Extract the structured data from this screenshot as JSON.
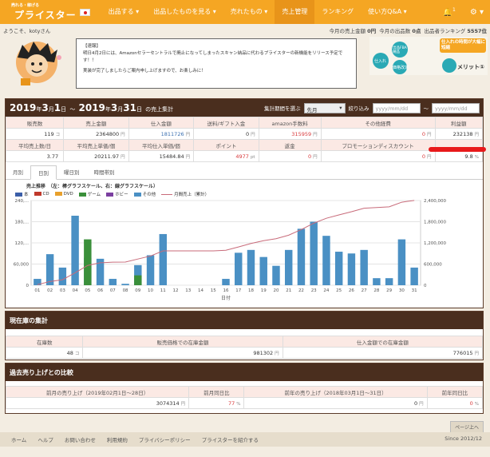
{
  "nav": {
    "logo_small": "売れる・稼げる",
    "logo": "プライスター",
    "items": [
      "出品する",
      "出品したものを見る",
      "売れたもの",
      "売上管理",
      "ランキング",
      "使い方Q&A"
    ],
    "notify_count": "1"
  },
  "subbar": {
    "welcome": "ようこそ、kotyさん",
    "today_sales_label": "今月の売上金額",
    "today_sales": "0円",
    "today_count_label": "今月の出品数",
    "today_count": "0点",
    "rank_label": "出品者ランキング",
    "rank": "5557位"
  },
  "notice": {
    "title": "【速報】",
    "line1": "明日4月2日には、Amazonセラーセントラルで廃止になってしまったスキャン納品に代わるプライスターの新機能をリリース予定です！！",
    "line2": "実装が完了しましたらご案内申し上げますので、お楽しみに！"
  },
  "banner": {
    "title": "仕入れの時間が大幅に短縮",
    "merit": "メリット①",
    "a": "仕入れ",
    "b": "出品FBA納品",
    "c": "価格改定"
  },
  "summary": {
    "year1": "2019",
    "month1": "3",
    "day1": "1",
    "year2": "2019",
    "month2": "3",
    "day2": "31",
    "suffix": "の売上集計",
    "y": "年",
    "m": "月",
    "d": "日",
    "tilde": "〜",
    "period_label": "集計期間を選ぶ",
    "period_value": "先月",
    "filter_label": "絞り込み",
    "date_ph": "yyyy/mm/dd",
    "labels1": [
      "販売数",
      "売上金額",
      "仕入金額",
      "送料/ギフト入金",
      "amazon手数料",
      "その他経費",
      "利益額"
    ],
    "values1": [
      "119",
      "2364800",
      "1811726",
      "0",
      "315959",
      "0",
      "232138"
    ],
    "units1": [
      "コ",
      "円",
      "円",
      "円",
      "円",
      "円",
      "円"
    ],
    "labels2": [
      "平均売上数/日",
      "平均売上単価/個",
      "平均仕入単価/個",
      "ポイント",
      "返金",
      "プロモーションディスカウント",
      ""
    ],
    "values2": [
      "3.77",
      "20211.97",
      "15484.84",
      "4977",
      "0",
      "0",
      "9.8"
    ],
    "units2": [
      "",
      "円",
      "円",
      "pt",
      "円",
      "円",
      "%"
    ]
  },
  "tabs": [
    "月別",
    "日別",
    "曜日別",
    "時間帯別"
  ],
  "chart_data": {
    "type": "bar",
    "title": "売上推移　（左：棒グラフスケール、右：線グラフスケール）",
    "xlabel": "日付",
    "categories": [
      "01",
      "02",
      "03",
      "04",
      "05",
      "06",
      "07",
      "08",
      "09",
      "10",
      "11",
      "12",
      "13",
      "14",
      "15",
      "16",
      "17",
      "18",
      "19",
      "20",
      "21",
      "22",
      "23",
      "24",
      "25",
      "26",
      "27",
      "28",
      "29",
      "30",
      "31"
    ],
    "ylim": [
      0,
      240000
    ],
    "y2lim": [
      0,
      2400000
    ],
    "yticks": [
      "240,...",
      "180,...",
      "120,...",
      "60,000",
      "0"
    ],
    "y2ticks": [
      "2,400,000",
      "1,800,000",
      "1,200,000",
      "600,000",
      "0"
    ],
    "legend": [
      "本",
      "CD",
      "DVD",
      "ゲーム",
      "ホビー",
      "その他",
      "月間売上（累計）"
    ],
    "colors": {
      "本": "#3b5ea8",
      "CD": "#c0392b",
      "DVD": "#e8a02c",
      "ゲーム": "#3a8f3a",
      "ホビー": "#7b3fa0",
      "その他": "#4a90c4",
      "line": "#c86b7a"
    },
    "series": [
      {
        "name": "その他",
        "values": [
          18000,
          88000,
          50000,
          45000,
          200000,
          80000,
          70000,
          20000,
          4000,
          70000,
          80000,
          10000,
          145000,
          0,
          0,
          0,
          0,
          18000,
          92000,
          100000,
          80000,
          55000,
          100000,
          150000,
          180000,
          140000,
          95000,
          90000,
          85000,
          100000,
          20000,
          0,
          0,
          110000,
          40000,
          10000,
          0,
          0,
          0,
          0
        ]
      },
      {
        "name": "ゲーム",
        "values": [
          0,
          0,
          0,
          0,
          0,
          0,
          0,
          130000,
          0,
          0,
          0,
          0,
          0,
          28000,
          0,
          0,
          0,
          0,
          0,
          0,
          0,
          0,
          0,
          0,
          0,
          0,
          0,
          0,
          0,
          0,
          0,
          0,
          0,
          0,
          0,
          0,
          0,
          0,
          0,
          0
        ]
      }
    ],
    "bars": [
      18000,
      88000,
      50000,
      197000,
      208000,
      75000,
      18000,
      4000,
      85000,
      85000,
      145000,
      0,
      0,
      0,
      0,
      18000,
      92000,
      100000,
      80000,
      55000,
      100000,
      160000,
      180000,
      140000,
      95000,
      90000,
      100000,
      20000,
      20000,
      130000,
      50000
    ],
    "game": [
      0,
      0,
      0,
      0,
      130000,
      0,
      0,
      0,
      28000,
      0,
      0,
      0,
      0,
      0,
      0,
      0,
      0,
      0,
      0,
      0,
      0,
      0,
      0,
      0,
      0,
      0,
      0,
      0,
      0,
      0,
      0
    ],
    "cumulative": [
      18000,
      106000,
      156000,
      353000,
      561000,
      636000,
      654000,
      658000,
      743000,
      828000,
      973000,
      973000,
      973000,
      973000,
      973000,
      991000,
      1083000,
      1183000,
      1263000,
      1318000,
      1418000,
      1578000,
      1758000,
      1898000,
      1993000,
      2083000,
      2183000,
      2203000,
      2223000,
      2353000,
      2403000
    ]
  },
  "stock": {
    "title": "現在庫の集計",
    "labels": [
      "在庫数",
      "販売価格での在庫金額",
      "仕入金額での在庫金額"
    ],
    "values": [
      "48",
      "981302",
      "776015"
    ],
    "units": [
      "コ",
      "円",
      "円"
    ]
  },
  "compare": {
    "title": "過去売り上げとの比較",
    "labels": [
      "前月の売り上げ（2019年02月1日〜28日）",
      "前月同日比",
      "前年の売り上げ（2018年03月1日〜31日）",
      "前年同日比"
    ],
    "values": [
      "3074314",
      "77",
      "0",
      "0"
    ],
    "units": [
      "円",
      "%",
      "円",
      "%"
    ]
  },
  "footer": {
    "links": [
      "ホーム",
      "ヘルプ",
      "お問い合わせ",
      "利用規約",
      "プライバシーポリシー",
      "プライスターを紹介する"
    ],
    "since": "Since 2012/12",
    "pageup": "ページ上へ"
  }
}
